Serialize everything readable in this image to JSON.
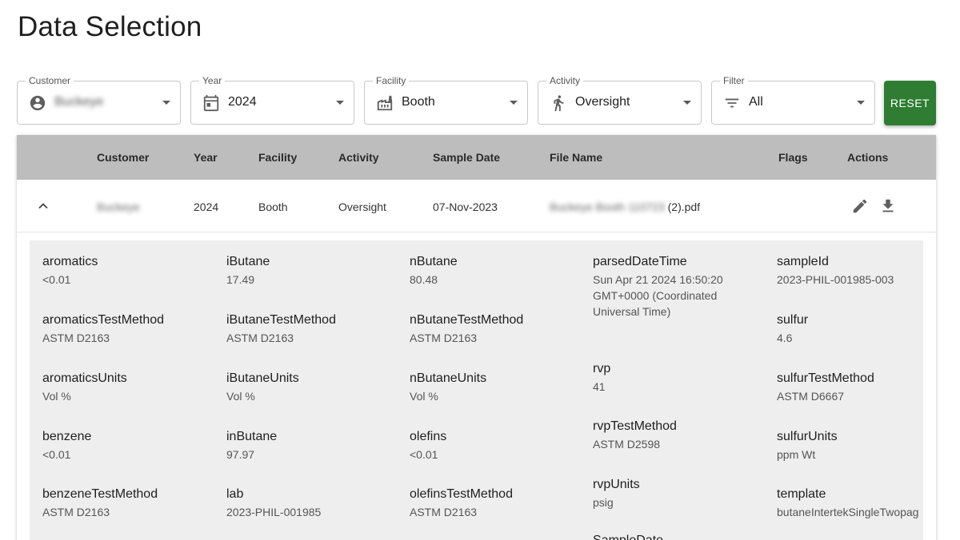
{
  "page": {
    "title": "Data Selection"
  },
  "filters": {
    "customer": {
      "label": "Customer",
      "value": "Buckeye",
      "icon": "account-circle-icon"
    },
    "year": {
      "label": "Year",
      "value": "2024",
      "icon": "calendar-icon"
    },
    "facility": {
      "label": "Facility",
      "value": "Booth",
      "icon": "factory-icon"
    },
    "activity": {
      "label": "Activity",
      "value": "Oversight",
      "icon": "walking-person-icon"
    },
    "filter": {
      "label": "Filter",
      "value": "All",
      "icon": "filter-list-icon"
    },
    "reset_label": "RESET"
  },
  "table": {
    "headers": [
      "Customer",
      "Year",
      "Facility",
      "Activity",
      "Sample Date",
      "File Name",
      "Flags",
      "Actions"
    ],
    "row": {
      "customer": "Buckeye",
      "year": "2024",
      "facility": "Booth",
      "activity": "Oversight",
      "sample_date": "07-Nov-2023",
      "file_name_prefix": "Buckeye Booth 110723",
      "file_name_suffix": " (2).pdf",
      "flags": "",
      "actions": [
        "edit-icon",
        "download-icon"
      ]
    }
  },
  "details": {
    "col1": [
      {
        "name": "aromatics",
        "value": "<0.01"
      },
      {
        "name": "aromaticsTestMethod",
        "value": "ASTM D2163"
      },
      {
        "name": "aromaticsUnits",
        "value": "Vol %"
      },
      {
        "name": "benzene",
        "value": "<0.01"
      },
      {
        "name": "benzeneTestMethod",
        "value": "ASTM D2163"
      }
    ],
    "col2": [
      {
        "name": "iButane",
        "value": "17.49"
      },
      {
        "name": "iButaneTestMethod",
        "value": "ASTM D2163"
      },
      {
        "name": "iButaneUnits",
        "value": "Vol %"
      },
      {
        "name": "inButane",
        "value": "97.97"
      },
      {
        "name": "lab",
        "value": "2023-PHIL-001985"
      }
    ],
    "col3": [
      {
        "name": "nButane",
        "value": "80.48"
      },
      {
        "name": "nButaneTestMethod",
        "value": "ASTM D2163"
      },
      {
        "name": "nButaneUnits",
        "value": "Vol %"
      },
      {
        "name": "olefins",
        "value": "<0.01"
      },
      {
        "name": "olefinsTestMethod",
        "value": "ASTM D2163"
      }
    ],
    "col4": [
      {
        "name": "parsedDateTime",
        "value": "Sun Apr 21 2024 16:50:20 GMT+0000 (Coordinated Universal Time)"
      },
      {
        "name": "rvp",
        "value": "41"
      },
      {
        "name": "rvpTestMethod",
        "value": "ASTM D2598"
      },
      {
        "name": "rvpUnits",
        "value": "psig"
      },
      {
        "name": "SampleDate",
        "value": ""
      }
    ],
    "col5": [
      {
        "name": "sampleId",
        "value": "2023-PHIL-001985-003"
      },
      {
        "name": "sulfur",
        "value": "4.6"
      },
      {
        "name": "sulfurTestMethod",
        "value": "ASTM D6667"
      },
      {
        "name": "sulfurUnits",
        "value": "ppm Wt"
      },
      {
        "name": "template",
        "value": "butaneIntertekSingleTwopag"
      }
    ]
  }
}
